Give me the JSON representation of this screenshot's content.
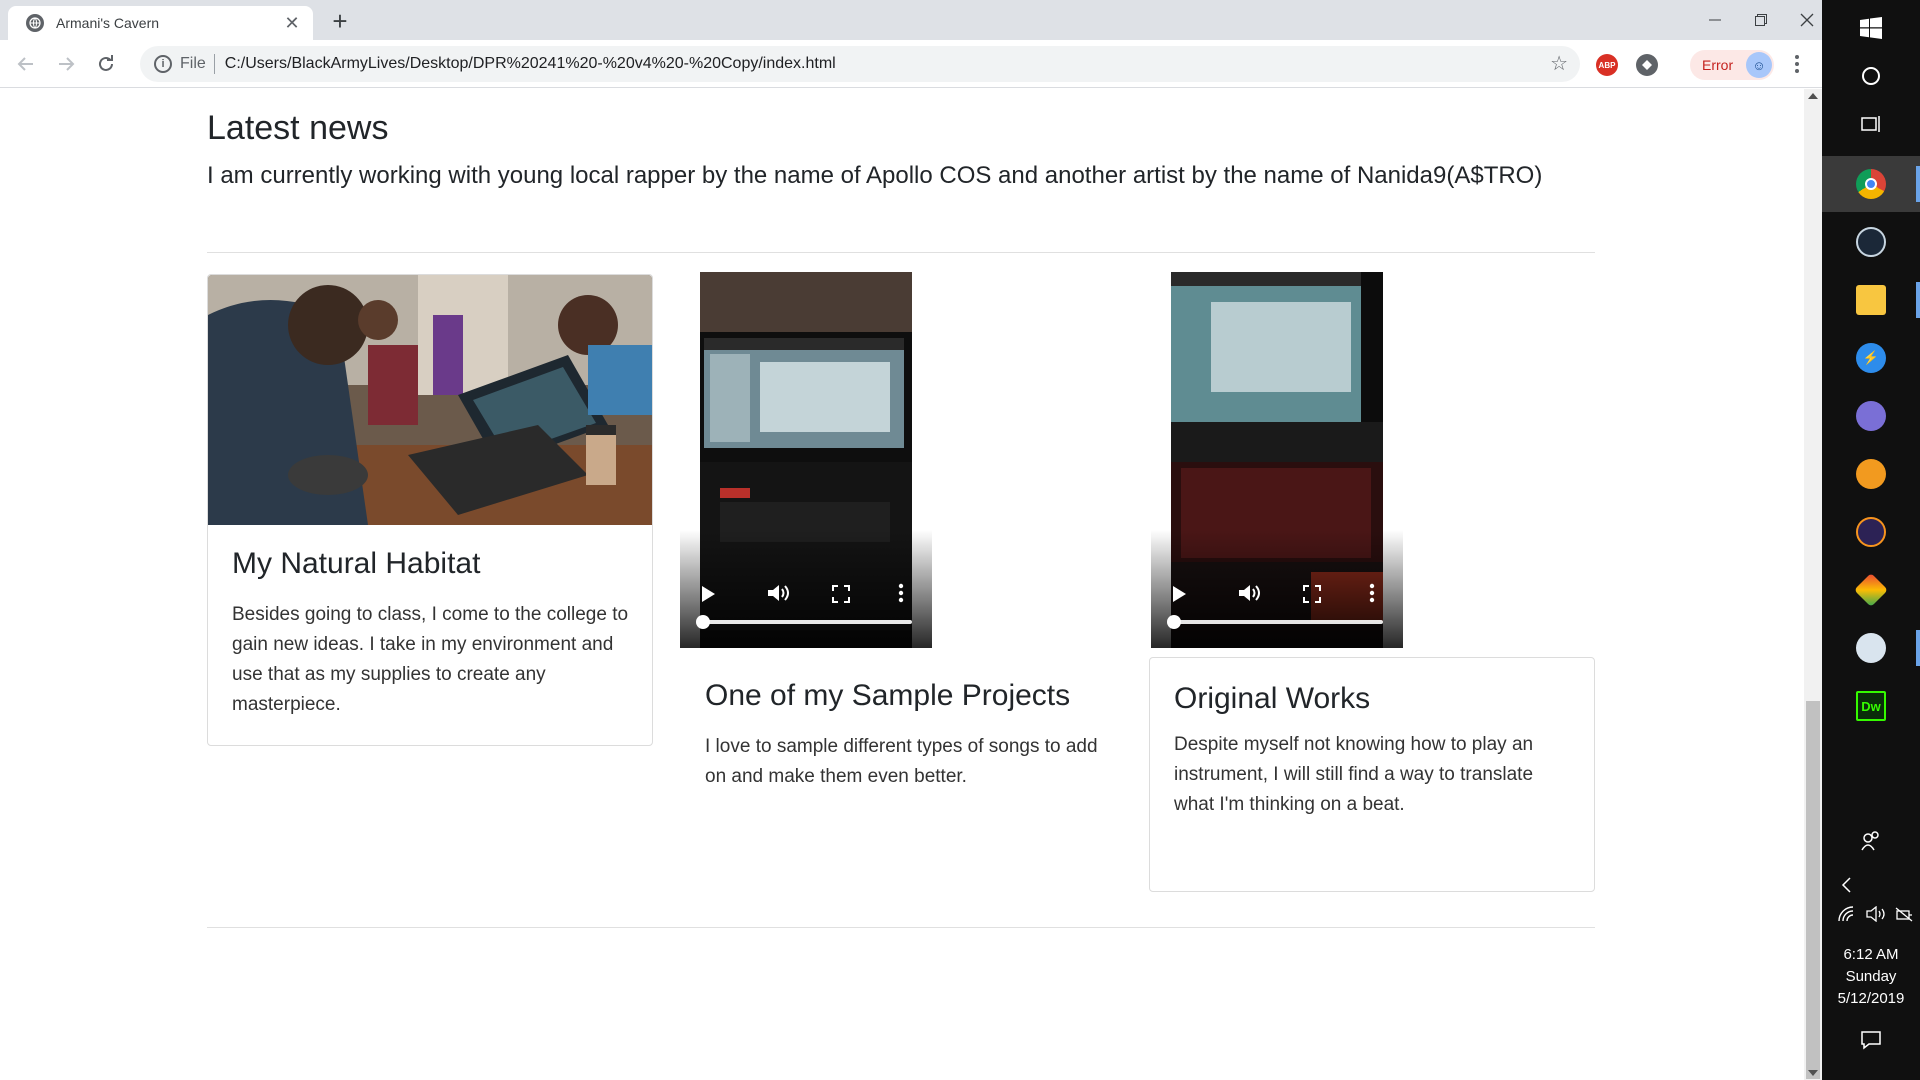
{
  "browser": {
    "tab_title": "Armani's Cavern",
    "url_scheme": "File",
    "url": "C:/Users/BlackArmyLives/Desktop/DPR%20241%20-%20v4%20-%20Copy/index.html",
    "profile_status": "Error",
    "ext_abp_label": "ABP"
  },
  "page": {
    "heading": "Latest news",
    "lead": "I am currently working with young local rapper by the name of Apollo COS and another artist by the name of Nanida9(A$TRO)"
  },
  "cards": [
    {
      "title": "My Natural Habitat",
      "text": "Besides going to class, I come to the college to gain new ideas. I take in my environment and use that as my supplies to create any masterpiece."
    },
    {
      "title": "One of my Sample Projects",
      "text": "I love to sample different types of songs to add on and make them even better."
    },
    {
      "title": "Original Works",
      "text": "Despite myself not knowing how to play an instrument, I will still find a way to translate what I'm thinking on a beat."
    }
  ],
  "taskbar": {
    "time": "6:12 AM",
    "day": "Sunday",
    "date": "5/12/2019",
    "dw_label": "Dw"
  },
  "colors": {
    "accent": "#4285f4",
    "error": "#c5221f",
    "taskbar_bg": "#101010"
  }
}
